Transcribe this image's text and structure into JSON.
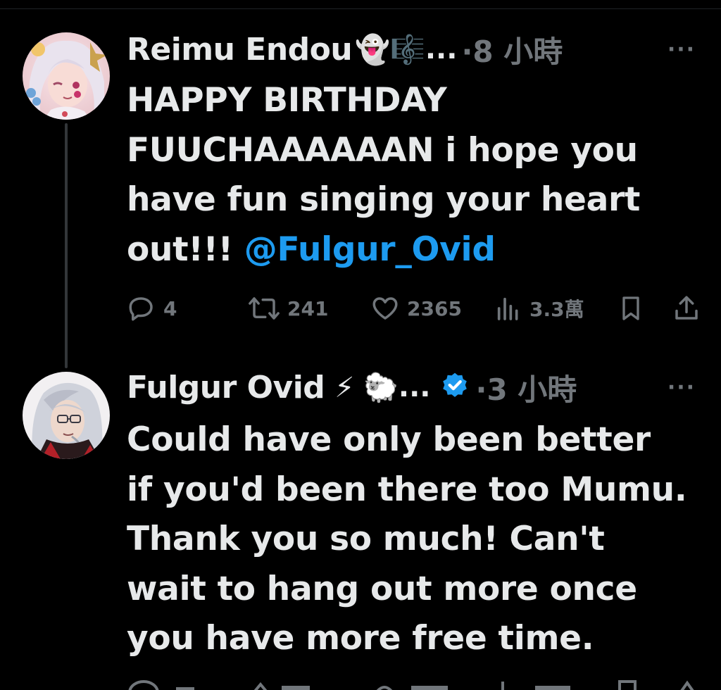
{
  "colors": {
    "background": "#000000",
    "text": "#e7e9ea",
    "muted": "#71767b",
    "link": "#1d9bf0",
    "thread_line": "#333639"
  },
  "tweets": [
    {
      "author": "Reimu Endou",
      "emojis": "👻🎼",
      "ellipsis": "...",
      "time": "·8 小時",
      "more": "···",
      "text": "HAPPY BIRTHDAY FUUCHAAAAAAN i hope you have fun singing your heart out!!! ",
      "mention": "@Fulgur_Ovid",
      "actions": {
        "reply_count": "4",
        "retweet_count": "241",
        "like_count": "2365",
        "view_count": "3.3萬"
      },
      "icons": [
        "reply-icon",
        "retweet-icon",
        "like-icon",
        "views-icon",
        "bookmark-icon",
        "share-icon"
      ]
    },
    {
      "author": "Fulgur Ovid",
      "emojis": "⚡ 🐑",
      "ellipsis": "...",
      "verified": true,
      "time": "·3 小時",
      "more": "···",
      "text_lines": [
        "Could have only been better",
        "if you'd been there too Mumu.",
        "Thank you so much! Can't",
        "wait to hang out more once",
        "you have more free time."
      ]
    }
  ]
}
